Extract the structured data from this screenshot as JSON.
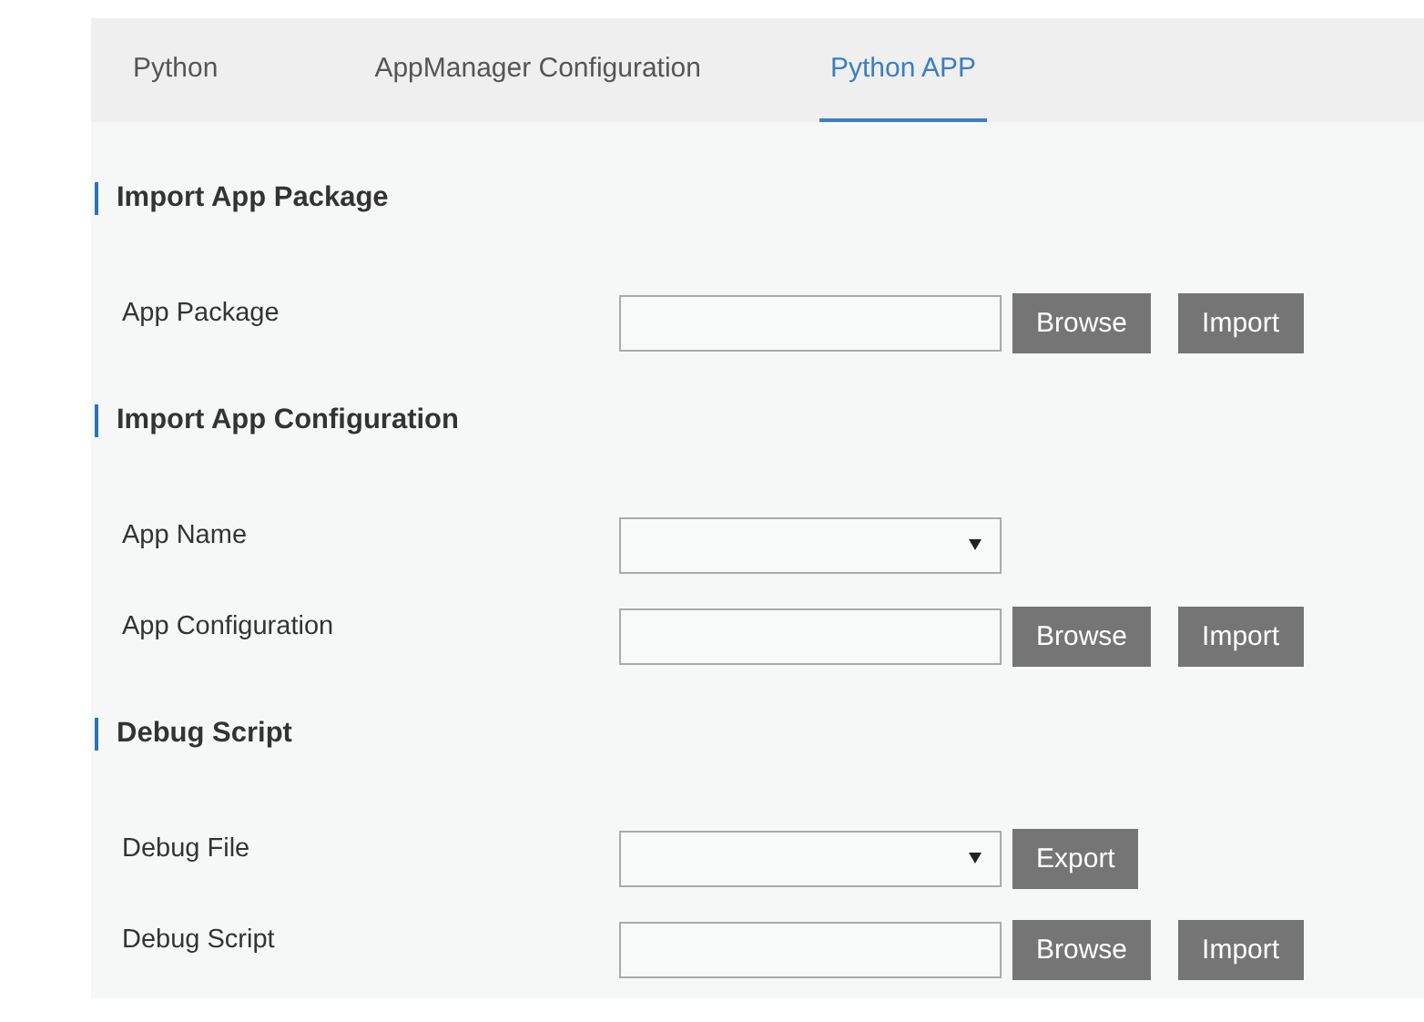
{
  "tabs": [
    {
      "label": "Python",
      "selected": false
    },
    {
      "label": "AppManager Configuration",
      "selected": false
    },
    {
      "label": "Python APP",
      "selected": true
    }
  ],
  "sections": [
    {
      "title": "Import App Package",
      "rows": [
        {
          "label": "App Package",
          "kind": "file",
          "buttons": [
            "Browse",
            "Import"
          ]
        }
      ]
    },
    {
      "title": "Import App Configuration",
      "rows": [
        {
          "label": "App Name",
          "kind": "select",
          "buttons": []
        },
        {
          "label": "App Configuration",
          "kind": "file",
          "buttons": [
            "Browse",
            "Import"
          ]
        }
      ]
    },
    {
      "title": "Debug Script",
      "rows": [
        {
          "label": "Debug File",
          "kind": "select",
          "buttons": [
            "Export"
          ]
        },
        {
          "label": "Debug Script",
          "kind": "file",
          "buttons": [
            "Browse",
            "Import"
          ]
        }
      ]
    }
  ]
}
